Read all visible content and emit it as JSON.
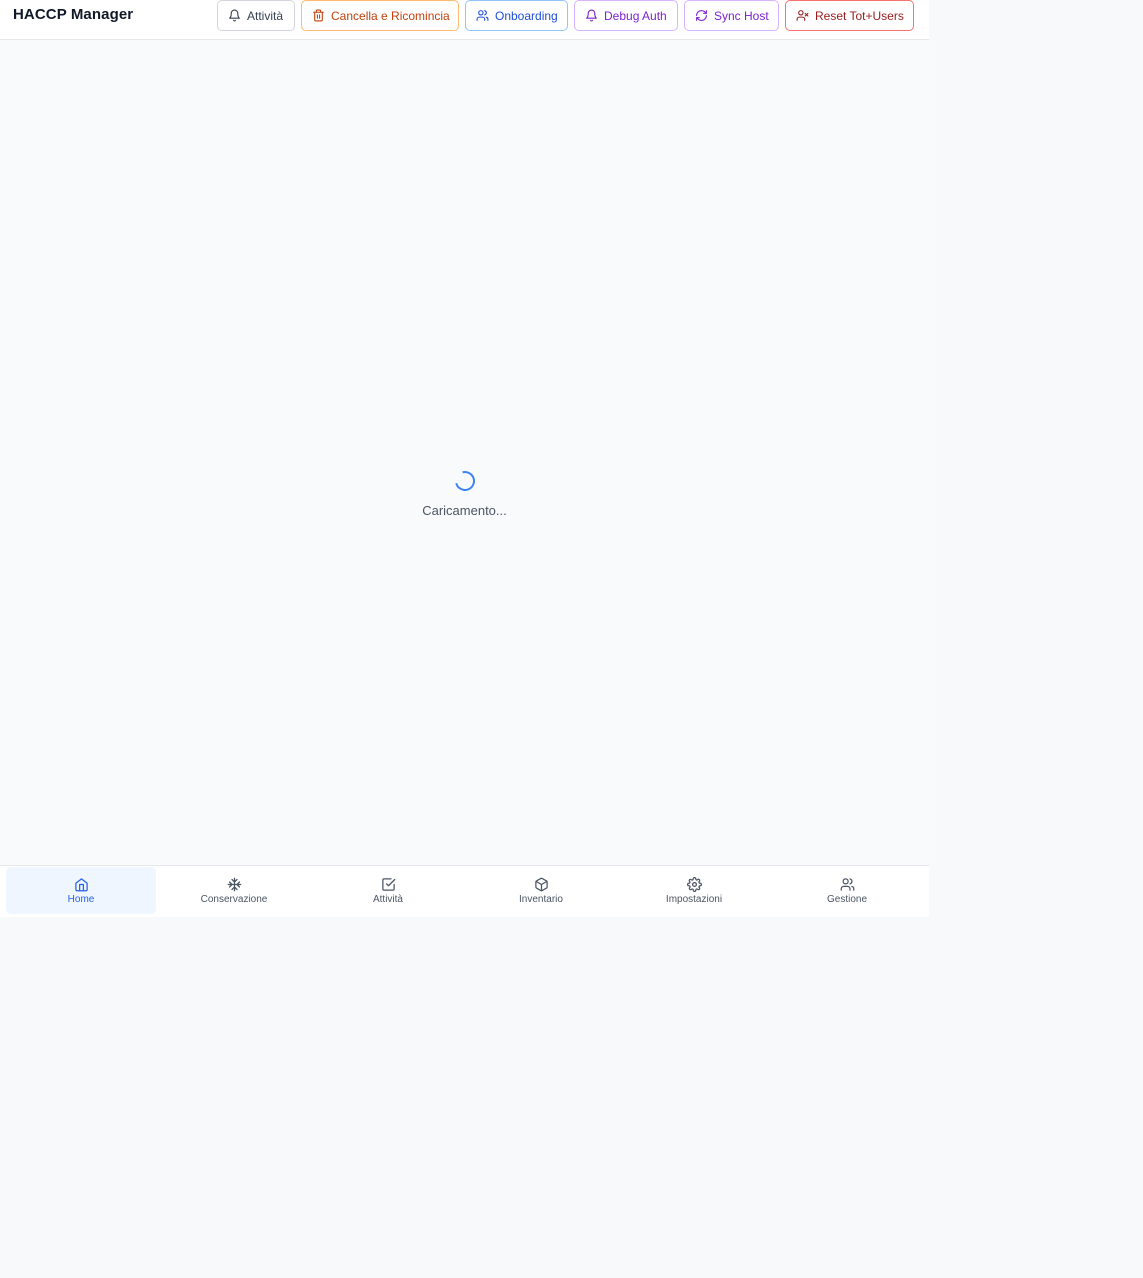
{
  "header": {
    "title": "HACCP Manager",
    "buttons": [
      {
        "label": "Attività",
        "icon": "bell-icon",
        "color": "#374151"
      },
      {
        "label": "Cancella e Ricomincia",
        "icon": "trash-icon",
        "color": "#c2410c"
      },
      {
        "label": "Onboarding",
        "icon": "users-icon",
        "color": "#1d4ed8"
      },
      {
        "label": "Debug Auth",
        "icon": "bell-icon",
        "color": "#7e22ce"
      },
      {
        "label": "Sync Host",
        "icon": "refresh-icon",
        "color": "#7e22ce"
      },
      {
        "label": "Reset Tot+Users",
        "icon": "user-x-icon",
        "color": "#991b1b"
      }
    ]
  },
  "main": {
    "loading_text": "Caricamento..."
  },
  "bottom_nav": {
    "items": [
      {
        "label": "Home",
        "icon": "home-icon",
        "active": true
      },
      {
        "label": "Conservazione",
        "icon": "snowflake-icon",
        "active": false
      },
      {
        "label": "Attività",
        "icon": "check-square-icon",
        "active": false
      },
      {
        "label": "Inventario",
        "icon": "package-icon",
        "active": false
      },
      {
        "label": "Impostazioni",
        "icon": "gear-icon",
        "active": false
      },
      {
        "label": "Gestione",
        "icon": "users-icon",
        "active": false
      }
    ]
  },
  "colors": {
    "accent": "#2563eb",
    "active_bg": "#eff6ff",
    "background": "#f9fafb"
  }
}
